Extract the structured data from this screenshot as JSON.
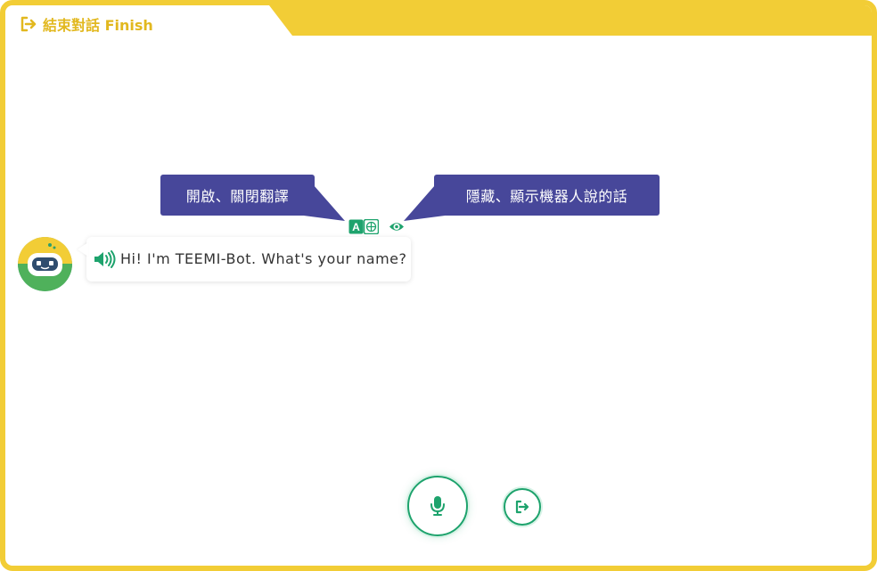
{
  "header": {
    "finish_label": "結束對話 Finish",
    "finish_icon": "exit-icon"
  },
  "chat": {
    "bot_avatar": "bot-avatar",
    "message": "Hi! I'm TEEMI-Bot. What's your name?",
    "speaker_icon": "speaker-icon"
  },
  "message_tools": {
    "translate_icon": "translate-icon",
    "visibility_icon": "eye-icon"
  },
  "tooltips": {
    "translate_tip": "開啟、關閉翻譯",
    "hide_tip": "隱藏、顯示機器人說的話"
  },
  "controls": {
    "mic_icon": "microphone-icon",
    "exit_icon": "exit-icon"
  },
  "colors": {
    "accent_yellow": "#f2cd36",
    "accent_green": "#1ea36d",
    "tooltip_bg": "#47479a"
  }
}
